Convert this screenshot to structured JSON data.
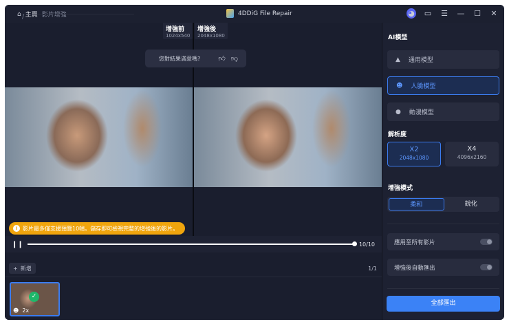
{
  "titlebar": {
    "home": "主頁",
    "separator": "/",
    "current": "影片增強",
    "app_title": "4DDiG File Repair"
  },
  "compare": {
    "before_label": "增強前",
    "before_res": "1024x540",
    "after_label": "增強後",
    "after_res": "2048x1080"
  },
  "feedback": {
    "question": "您對結果滿意嗎?"
  },
  "notice": "影片最多僅支援預覽10幀。儲存即可檢視完整的增強後的影片。",
  "player": {
    "frames": "10/10",
    "progress": 1.0
  },
  "list": {
    "add_label": "新增",
    "pager": "1/1",
    "thumb_scale": "2x"
  },
  "side": {
    "model_heading": "AI模型",
    "models": [
      {
        "label": "通用模型",
        "icon": "landscape-icon"
      },
      {
        "label": "人臉模型",
        "icon": "face-icon"
      },
      {
        "label": "動漫模型",
        "icon": "bear-icon"
      }
    ],
    "res_heading": "解析度",
    "resolutions": [
      {
        "label": "X2",
        "size": "2048x1080"
      },
      {
        "label": "X4",
        "size": "4096x2160"
      }
    ],
    "mode_heading": "增強模式",
    "modes": [
      "柔和",
      "銳化"
    ],
    "toggles": [
      {
        "label": "應用至所有影片",
        "on": false
      },
      {
        "label": "增強後自動匯出",
        "on": false
      }
    ],
    "export_label": "全部匯出"
  }
}
